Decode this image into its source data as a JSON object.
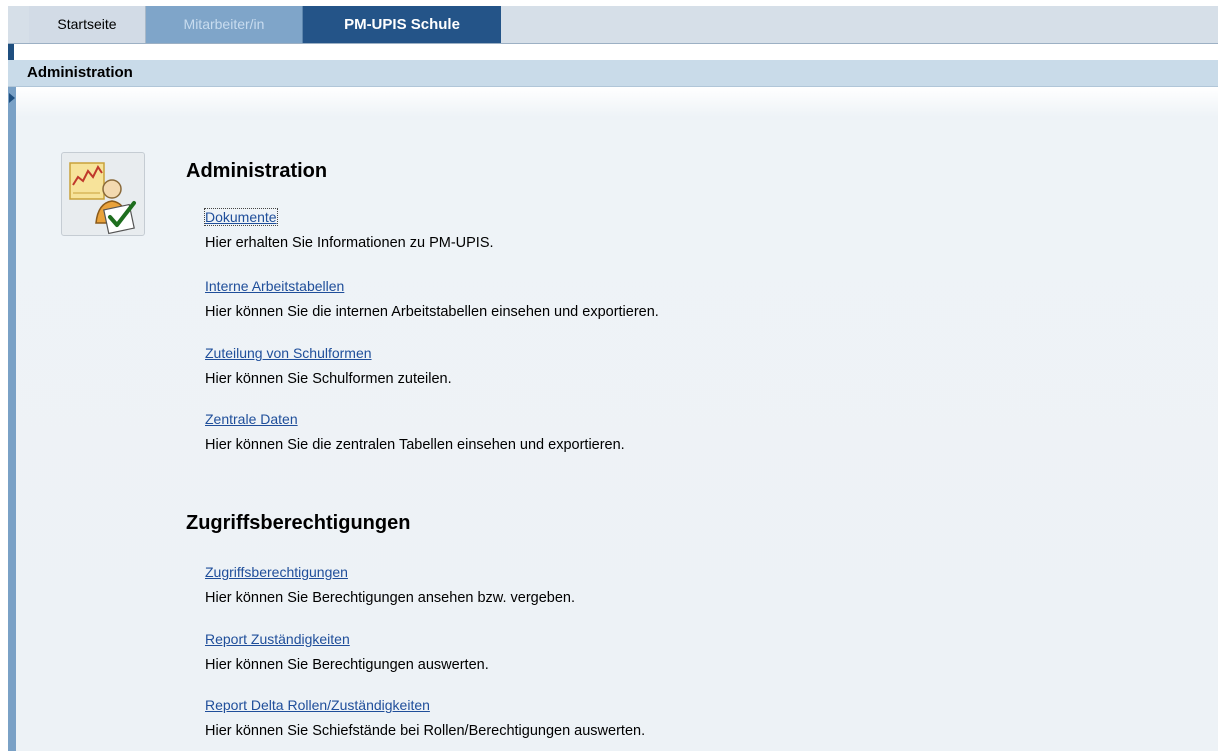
{
  "tabs": [
    {
      "label": "Startseite"
    },
    {
      "label": "Mitarbeiter/in"
    },
    {
      "label": "PM-UPIS Schule"
    }
  ],
  "subheader": {
    "title": "Administration"
  },
  "sections": [
    {
      "heading": "Administration",
      "items": [
        {
          "link": "Dokumente",
          "description": "Hier erhalten Sie Informationen zu PM-UPIS."
        },
        {
          "link": "Interne Arbeitstabellen",
          "description": "Hier können Sie die internen Arbeitstabellen einsehen und exportieren."
        },
        {
          "link": "Zuteilung von Schulformen",
          "description": "Hier können Sie Schulformen zuteilen."
        },
        {
          "link": "Zentrale Daten",
          "description": "Hier können Sie die zentralen Tabellen einsehen und exportieren."
        }
      ]
    },
    {
      "heading": "Zugriffsberechtigungen",
      "items": [
        {
          "link": "Zugriffsberechtigungen",
          "description": "Hier können Sie Berechtigungen ansehen bzw. vergeben."
        },
        {
          "link": "Report Zuständigkeiten",
          "description": "Hier können Sie Berechtigungen auswerten."
        },
        {
          "link": "Report Delta Rollen/Zuständigkeiten",
          "description": "Hier können Sie Schiefstände bei Rollen/Berechtigungen auswerten."
        }
      ]
    }
  ],
  "colors": {
    "active_tab": "#245488",
    "link": "#1f4e9a",
    "content_bg": "#edf2f6"
  },
  "icons": {
    "section_icon": "administration-person-chart-check-icon",
    "toggle": "expand-triangle-icon"
  }
}
